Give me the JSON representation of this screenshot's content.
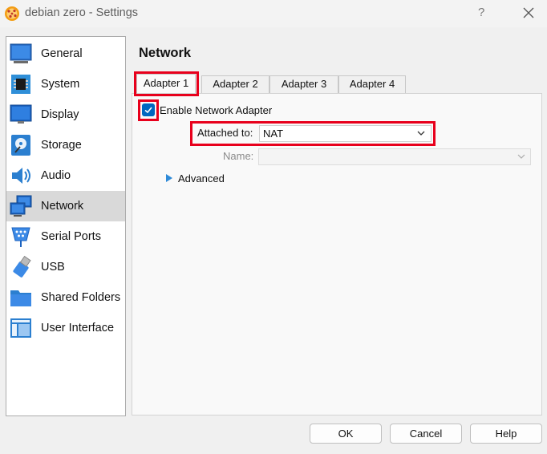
{
  "window": {
    "title": "debian zero - Settings",
    "help_glyph": "?"
  },
  "sidebar": {
    "items": [
      {
        "label": "General",
        "icon": "general-icon"
      },
      {
        "label": "System",
        "icon": "system-chip-icon"
      },
      {
        "label": "Display",
        "icon": "display-monitor-icon"
      },
      {
        "label": "Storage",
        "icon": "storage-disk-icon"
      },
      {
        "label": "Audio",
        "icon": "audio-speaker-icon"
      },
      {
        "label": "Network",
        "icon": "network-icon",
        "active": true
      },
      {
        "label": "Serial Ports",
        "icon": "serial-port-icon"
      },
      {
        "label": "USB",
        "icon": "usb-icon"
      },
      {
        "label": "Shared Folders",
        "icon": "folder-icon"
      },
      {
        "label": "User Interface",
        "icon": "user-interface-icon"
      }
    ]
  },
  "page": {
    "title": "Network"
  },
  "tabs": [
    {
      "label": "Adapter 1",
      "active": true
    },
    {
      "label": "Adapter 2"
    },
    {
      "label": "Adapter 3"
    },
    {
      "label": "Adapter 4"
    }
  ],
  "adapter": {
    "enable_label": "Enable Network Adapter",
    "enabled": true,
    "attached_label": "Attached to:",
    "attached_value": "NAT",
    "name_label": "Name:",
    "name_value": "",
    "advanced_label": "Advanced"
  },
  "buttons": {
    "ok": "OK",
    "cancel": "Cancel",
    "help": "Help"
  },
  "colors": {
    "accent": "#0067c0",
    "highlight_box": "#e8001c",
    "selected_item": "#d9d9d9"
  }
}
